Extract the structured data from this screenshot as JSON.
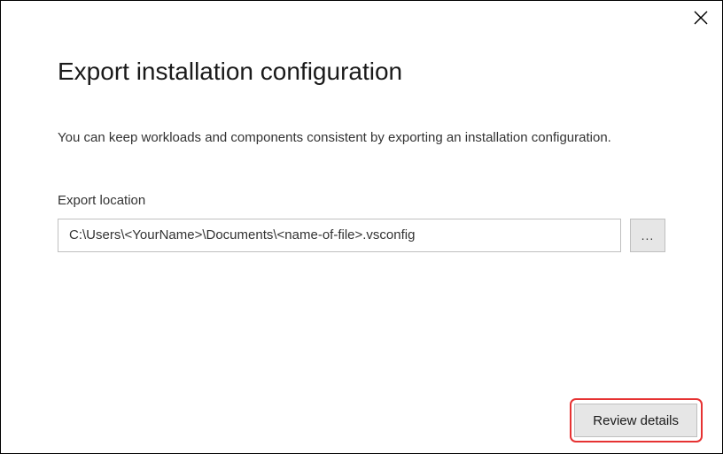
{
  "dialog": {
    "title": "Export installation configuration",
    "description": "You can keep workloads and components consistent by exporting an installation configuration.",
    "field_label": "Export location",
    "path_value": "C:\\Users\\<YourName>\\Documents\\<name-of-file>.vsconfig",
    "browse_label": "...",
    "review_label": "Review details"
  }
}
